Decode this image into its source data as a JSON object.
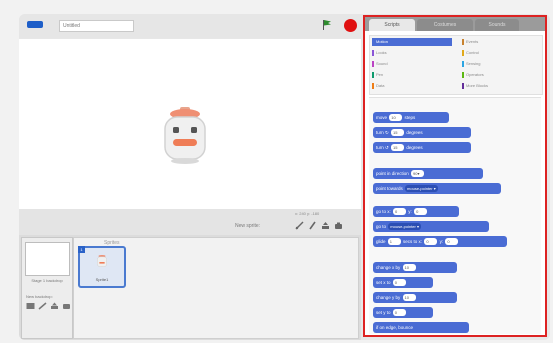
{
  "app": {
    "accent": "#4a6cd4",
    "stop_color": "#e01010",
    "flag_color": "#2e8b2e",
    "highlight_border": "#dd2222"
  },
  "header": {
    "version_badge_icon": "version-badge-icon",
    "project_title": "Untitled",
    "flag_icon": "green-flag-icon",
    "stop_icon": "stop-sign-icon"
  },
  "stage_toolbar": {
    "coords": "x: 240  y: -180",
    "new_sprite_label": "New sprite:",
    "tools": [
      "paint-new-sprite-icon",
      "choose-sprite-icon",
      "upload-sprite-icon",
      "camera-icon"
    ]
  },
  "stage_panel": {
    "thumb_label": "Stage 1 backdrop",
    "new_backdrop_label": "New backdrop:",
    "backdrop_tools": [
      "paint-backdrop-icon",
      "choose-backdrop-icon",
      "upload-backdrop-icon",
      "camera-backdrop-icon"
    ]
  },
  "sprites_panel": {
    "title": "Sprites",
    "items": [
      {
        "number": "1",
        "name": "Sprite1"
      }
    ]
  },
  "tabs": [
    "Scripts",
    "Costumes",
    "Sounds"
  ],
  "categories": {
    "left": [
      {
        "label": "Motion",
        "color": "#4a6cd4",
        "selected": true
      },
      {
        "label": "Looks",
        "color": "#8a55d7"
      },
      {
        "label": "Sound",
        "color": "#bb42c3"
      },
      {
        "label": "Pen",
        "color": "#0e9a6c"
      },
      {
        "label": "Data",
        "color": "#ee7d16"
      }
    ],
    "right": [
      {
        "label": "Events",
        "color": "#c88330"
      },
      {
        "label": "Control",
        "color": "#e1a91a"
      },
      {
        "label": "Sensing",
        "color": "#2ca5e2"
      },
      {
        "label": "Operators",
        "color": "#5cb712"
      },
      {
        "label": "More Blocks",
        "color": "#632d99"
      }
    ]
  },
  "blocks": {
    "move": {
      "pre": "move",
      "val": "10",
      "post": "steps"
    },
    "turn_right": {
      "pre": "turn ↻",
      "val": "15",
      "post": "degrees"
    },
    "turn_left": {
      "pre": "turn ↺",
      "val": "15",
      "post": "degrees"
    },
    "point_dir": {
      "pre": "point in direction",
      "val": "90▾"
    },
    "point_towards": {
      "pre": "point towards",
      "val": "mouse-pointer ▾"
    },
    "go_to_xy": {
      "pre": "go to x:",
      "x": "0",
      "mid": "y:",
      "y": "0"
    },
    "go_to": {
      "pre": "go to",
      "val": "mouse-pointer ▾"
    },
    "glide": {
      "pre": "glide",
      "secs": "1",
      "mid": "secs to x:",
      "x": "0",
      "mid2": "y:",
      "y": "0"
    },
    "change_x": {
      "pre": "change x by",
      "val": "10"
    },
    "set_x": {
      "pre": "set x to",
      "val": "0"
    },
    "change_y": {
      "pre": "change y by",
      "val": "10"
    },
    "set_y": {
      "pre": "set y to",
      "val": "0"
    },
    "bounce": {
      "text": "if on edge, bounce"
    }
  }
}
